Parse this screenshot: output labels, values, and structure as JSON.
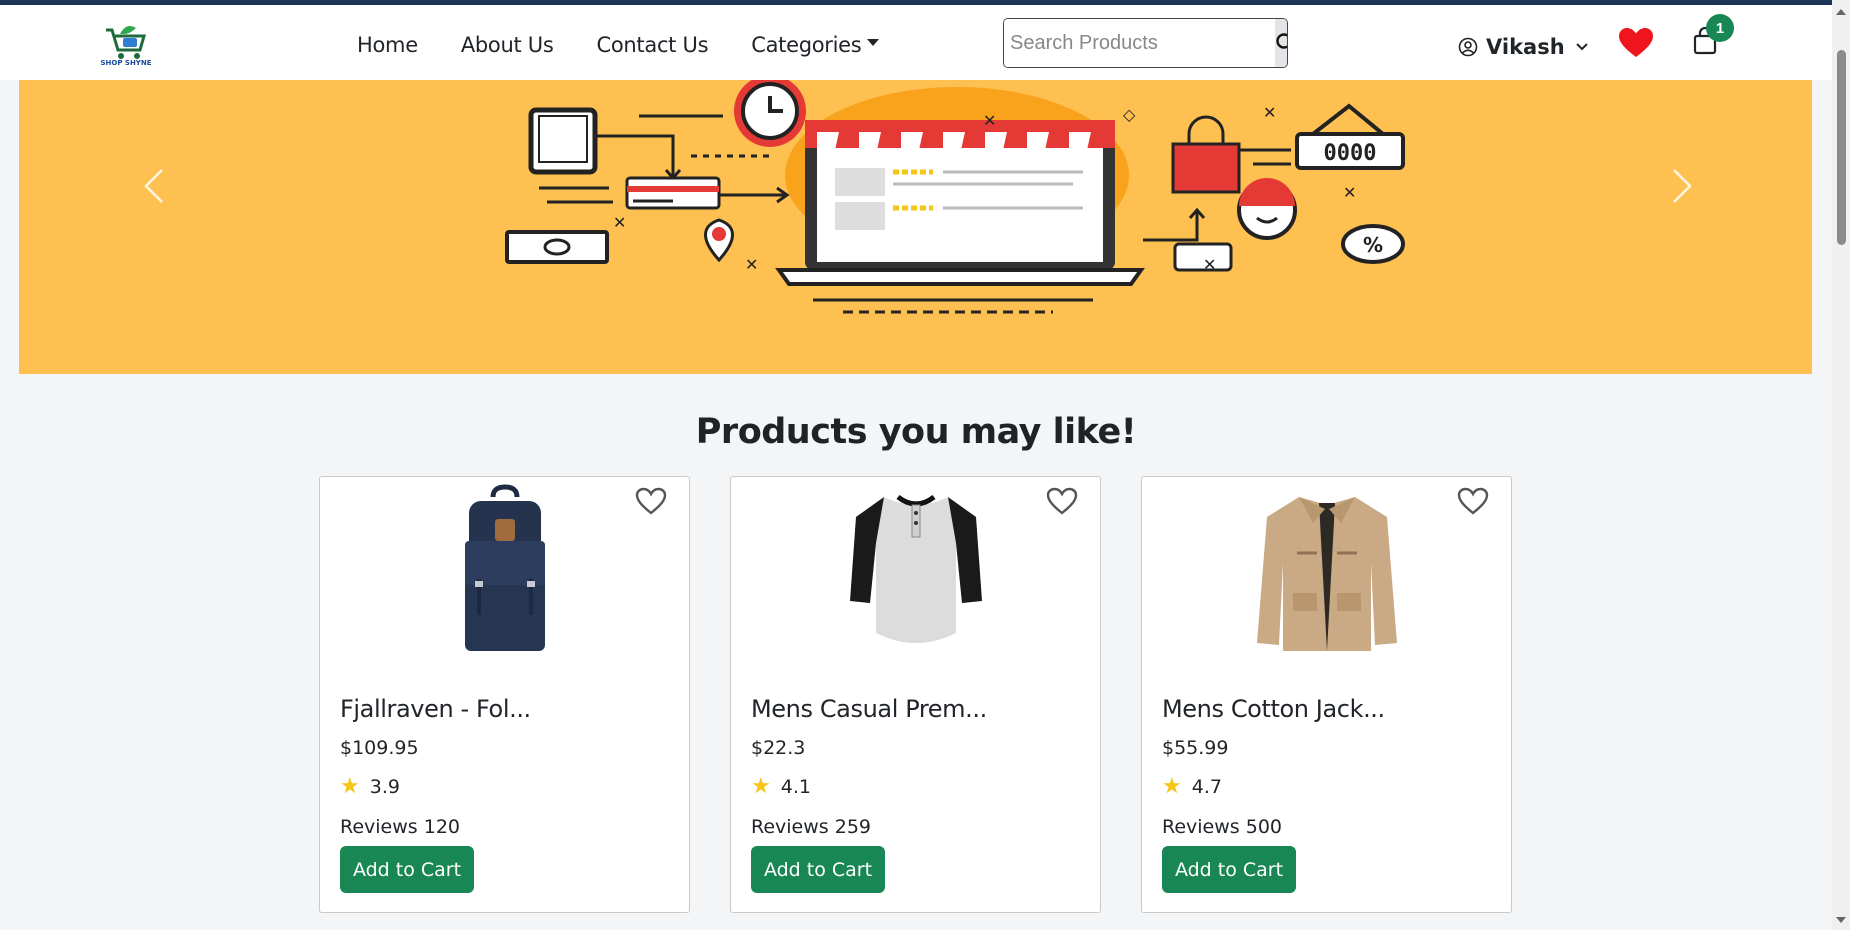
{
  "brand": {
    "logo_text": "SHOP SHYNE"
  },
  "nav": {
    "links": [
      {
        "label": "Home"
      },
      {
        "label": "About Us"
      },
      {
        "label": "Contact Us"
      },
      {
        "label": "Categories"
      }
    ]
  },
  "search": {
    "placeholder": "Search Products",
    "value": ""
  },
  "user": {
    "name": "Vikash"
  },
  "cart": {
    "count": "1"
  },
  "section": {
    "title": "Products you may like!"
  },
  "products": [
    {
      "name": "Fjallraven - Fol...",
      "price": "$109.95",
      "rating": "3.9",
      "reviews": "Reviews 120",
      "cta": "Add to Cart"
    },
    {
      "name": "Mens Casual Prem...",
      "price": "$22.3",
      "rating": "4.1",
      "reviews": "Reviews 259",
      "cta": "Add to Cart"
    },
    {
      "name": "Mens Cotton Jack...",
      "price": "$55.99",
      "rating": "4.7",
      "reviews": "Reviews 500",
      "cta": "Add to Cart"
    }
  ],
  "colors": {
    "accent": "#198754",
    "hero_bg": "#fdc051",
    "heart": "#f0141e",
    "star": "#f5c518"
  }
}
